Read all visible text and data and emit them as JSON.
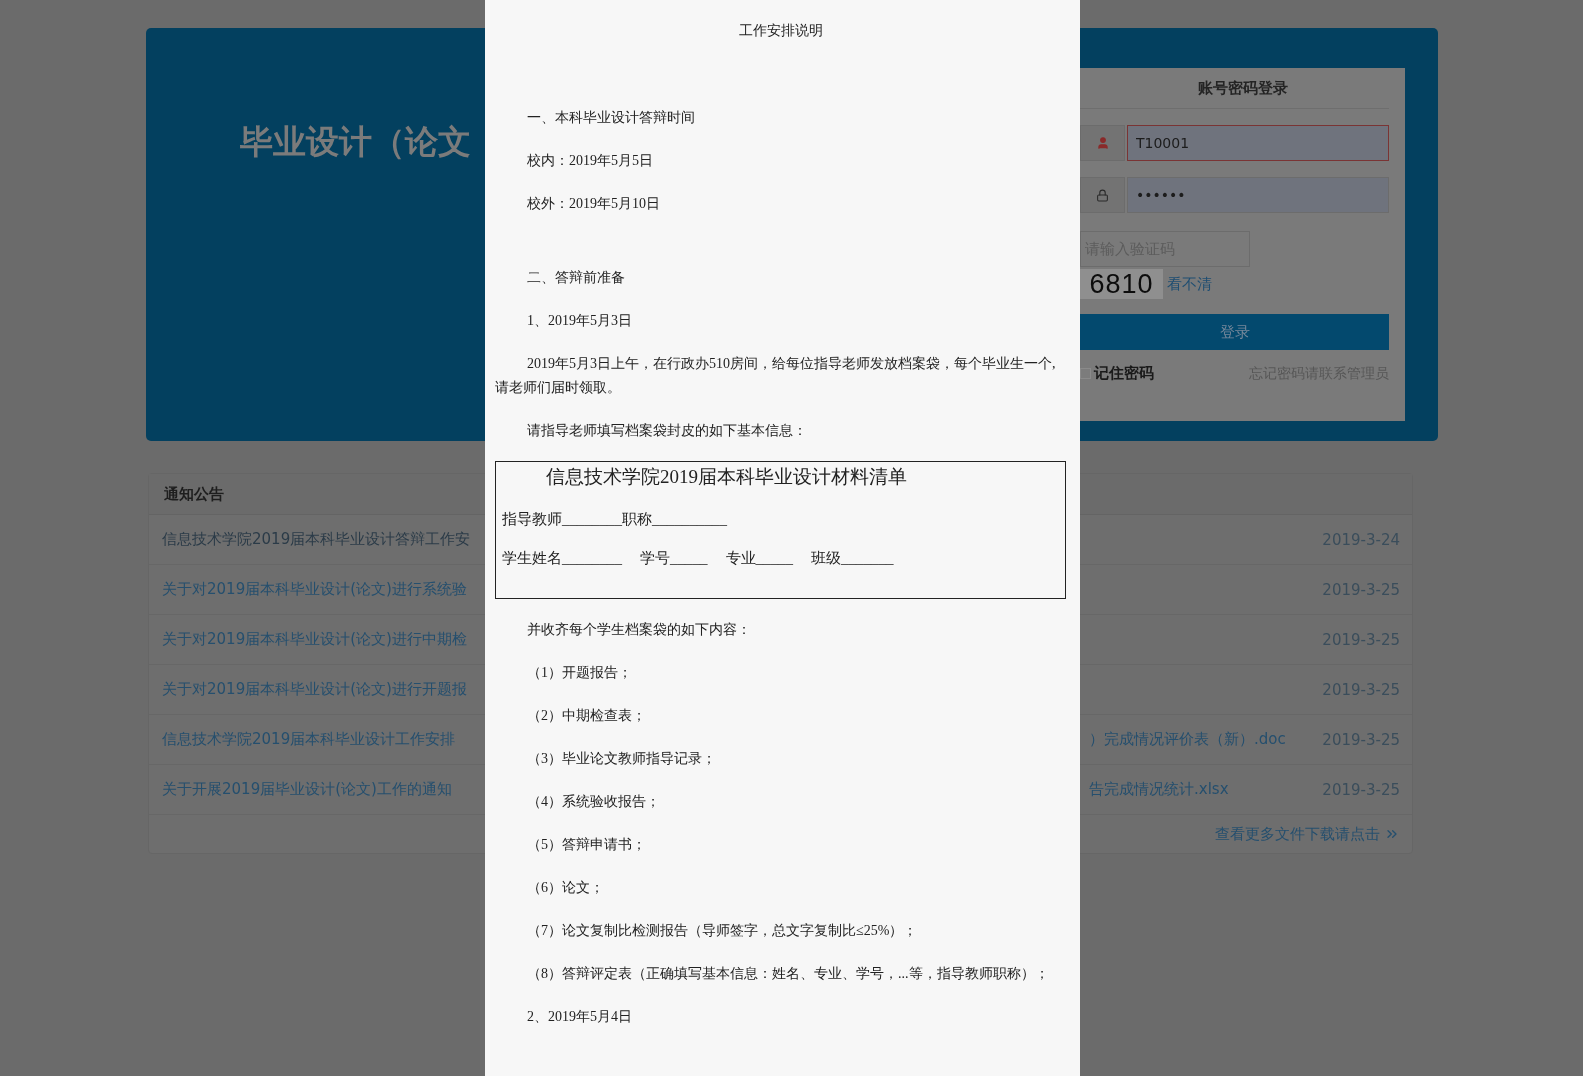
{
  "hero": {
    "title": "毕业设计（论文"
  },
  "login": {
    "heading": "账号密码登录",
    "username": {
      "value": "T10001",
      "invalid": true
    },
    "password": {
      "value": "••••••"
    },
    "captcha": {
      "placeholder": "请输入验证码",
      "code": "6810",
      "refresh": "看不清"
    },
    "submit": "登录",
    "remember": {
      "label": "记住密码",
      "checked": false
    },
    "forgot": "忘记密码请联系管理员"
  },
  "notices": {
    "heading": "通知公告",
    "rows": [
      {
        "title": "信息技术学院2019届本科毕业设计答辩工作安",
        "date": "2019-3-24",
        "kind": "plain"
      },
      {
        "title": "关于对2019届本科毕业设计(论文)进行系统验",
        "date": "2019-3-25",
        "kind": "link"
      },
      {
        "title": "关于对2019届本科毕业设计(论文)进行中期检",
        "date": "2019-3-25",
        "kind": "link"
      },
      {
        "title": "关于对2019届本科毕业设计(论文)进行开题报",
        "date": "2019-3-25",
        "kind": "link"
      },
      {
        "title": "信息技术学院2019届本科毕业设计工作安排",
        "file": "）完成情况评价表（新）.doc",
        "date": "2019-3-25",
        "kind": "link"
      },
      {
        "title": "关于开展2019届毕业设计(论文)工作的通知",
        "file": "告完成情况统计.xlsx",
        "date": "2019-3-25",
        "kind": "link"
      }
    ],
    "more": "查看更多文件下载请点击"
  },
  "document": {
    "title": "工作安排说明",
    "blocks": [
      {
        "kind": "heading",
        "text": "一、本科毕业设计答辩时间"
      },
      {
        "kind": "para",
        "text": "校内：2019年5月5日"
      },
      {
        "kind": "para",
        "text": "校外：2019年5月10日"
      },
      {
        "kind": "heading",
        "text": "二、答辩前准备"
      },
      {
        "kind": "para",
        "text": "1、2019年5月3日"
      },
      {
        "kind": "para",
        "text": "2019年5月3日上午，在行政办510房间，给每位指导老师发放档案袋，每个毕业生一个,请老师们届时领取。"
      },
      {
        "kind": "para",
        "text": "请指导老师填写档案袋封皮的如下基本信息："
      },
      {
        "kind": "form",
        "title": "信息技术学院2019届本科毕业设计材料清单",
        "lines": [
          [
            "指导教师________",
            "职称__________"
          ],
          [
            "学生姓名________",
            "学号_____",
            "专业_____",
            "班级_______"
          ]
        ]
      },
      {
        "kind": "para",
        "text": "并收齐每个学生档案袋的如下内容："
      },
      {
        "kind": "para",
        "text": "（1）开题报告；"
      },
      {
        "kind": "para",
        "text": "（2）中期检查表；"
      },
      {
        "kind": "para",
        "text": "（3）毕业论文教师指导记录；"
      },
      {
        "kind": "para",
        "text": "（4）系统验收报告；"
      },
      {
        "kind": "para",
        "text": "（5）答辩申请书；"
      },
      {
        "kind": "para",
        "text": "（6）论文；"
      },
      {
        "kind": "para",
        "text": "（7）论文复制比检测报告（导师签字，总文字复制比≤25%）；"
      },
      {
        "kind": "para",
        "text": "（8）答辩评定表（正确填写基本信息：姓名、专业、学号，...等，指导教师职称）；"
      },
      {
        "kind": "para",
        "text": "2、2019年5月4日"
      }
    ]
  }
}
